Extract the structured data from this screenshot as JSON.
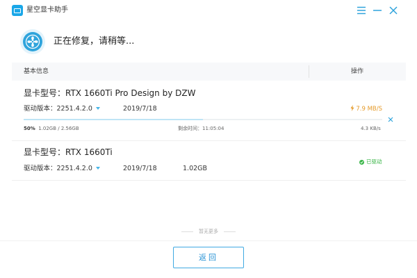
{
  "app": {
    "title": "星空显卡助手",
    "icon": "monitor-icon",
    "accent_color": "#2fa4dc"
  },
  "window_controls": {
    "menu_icon": "menu-icon",
    "minimize_icon": "minimize-icon",
    "close_icon": "close-icon"
  },
  "header": {
    "status": "正在修复，请稍等...",
    "icon": "fan-icon"
  },
  "table": {
    "col_basic": "基本信息",
    "col_action": "操作"
  },
  "drivers": [
    {
      "model": "显卡型号：RTX 1660Ti Pro Design by DZW",
      "version_label": "驱动版本：",
      "version": "2251.4.2.0",
      "date": "2019/7/18",
      "speed": "7.9 MB/S",
      "speed_color": "#e59b2a",
      "progress_percent": 50,
      "progress_text": "50%",
      "downloaded": "1.02GB / 2.56GB",
      "remaining": "剩余时间：11:05:04",
      "current_speed": "4.3 KB/s"
    },
    {
      "model": "显卡型号：RTX 1660Ti",
      "version_label": "驱动版本：",
      "version": "2251.4.2.0",
      "date": "2019/7/18",
      "size": "1.02GB",
      "status": "已驱动",
      "status_color": "#3cb64a"
    }
  ],
  "list_end": "暂无更多",
  "footer": {
    "back_label": "返回"
  }
}
